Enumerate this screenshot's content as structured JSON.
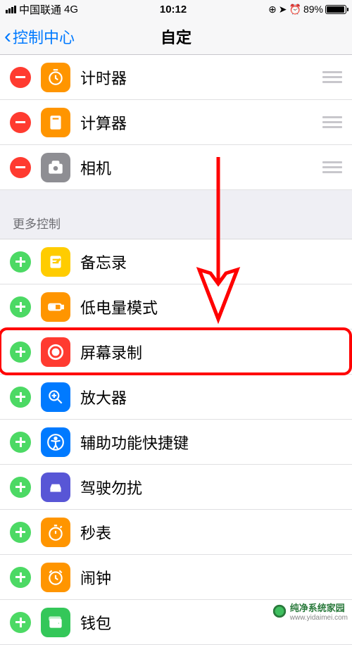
{
  "status": {
    "carrier": "中国联通",
    "network": "4G",
    "time": "10:12",
    "battery_pct": "89%"
  },
  "nav": {
    "back_label": "控制中心",
    "title": "自定"
  },
  "included": [
    {
      "label": "计时器",
      "icon": "timer",
      "bg": "#ff9500"
    },
    {
      "label": "计算器",
      "icon": "calculator",
      "bg": "#ff9500"
    },
    {
      "label": "相机",
      "icon": "camera",
      "bg": "#8e8e93"
    }
  ],
  "more_header": "更多控制",
  "more": [
    {
      "label": "备忘录",
      "icon": "notes",
      "bg": "#ffcc00"
    },
    {
      "label": "低电量模式",
      "icon": "lowpower",
      "bg": "#ff9500"
    },
    {
      "label": "屏幕录制",
      "icon": "record",
      "bg": "#ff3b30"
    },
    {
      "label": "放大器",
      "icon": "magnifier",
      "bg": "#007aff"
    },
    {
      "label": "辅助功能快捷键",
      "icon": "accessibility",
      "bg": "#007aff"
    },
    {
      "label": "驾驶勿扰",
      "icon": "car",
      "bg": "#5856d6"
    },
    {
      "label": "秒表",
      "icon": "stopwatch",
      "bg": "#ff9500"
    },
    {
      "label": "闹钟",
      "icon": "alarm",
      "bg": "#ff9500"
    },
    {
      "label": "钱包",
      "icon": "wallet",
      "bg": "#34c759"
    }
  ],
  "annotation": {
    "highlight_index": 2,
    "arrow": true
  },
  "watermark": {
    "brand": "纯净系统家园",
    "url": "www.yidaimei.com"
  }
}
